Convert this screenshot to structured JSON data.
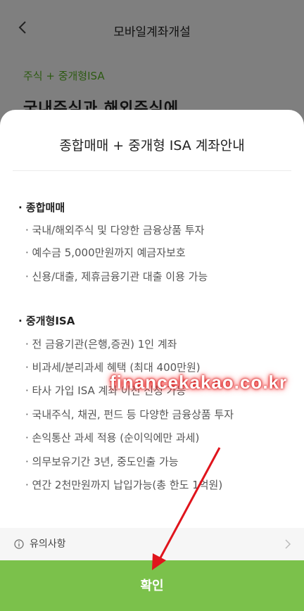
{
  "header": {
    "title": "모바일계좌개설"
  },
  "background": {
    "subtitle": "주식 + 중개형ISA",
    "heading": "국내주식과 해외주식에"
  },
  "sheet": {
    "title": "종합매매 + 중개형 ISA 계좌안내",
    "sections": [
      {
        "title": "· 종합매매",
        "items": [
          "· 국내/해외주식 및 다양한 금융상품 투자",
          "· 예수금 5,000만원까지 예금자보호",
          "· 신용/대출, 제휴금융기관 대출 이용 가능"
        ]
      },
      {
        "title": "· 중개형ISA",
        "items": [
          "· 전 금융기관(은행,증권) 1인 계좌",
          "· 비과세/분리과세 혜택 (최대 400만원)",
          "· 타사 가입 ISA 계좌 이전 신청 가능",
          "· 국내주식, 채권, 펀드 등 다양한 금융상품 투자",
          "· 손익통산 과세 적용 (순이익에만 과세)",
          "· 의무보유기간 3년, 중도인출 가능",
          "· 연간 2천만원까지 납입가능(총 한도 1억원)"
        ]
      }
    ],
    "notice_label": "유의사항",
    "confirm_label": "확인"
  },
  "overlay": {
    "watermark": "financekakao.co.kr",
    "arrow_color": "#e0141c"
  },
  "icons": {
    "back": "back-arrow-icon",
    "info": "info-icon",
    "chevron": "chevron-right-icon"
  },
  "colors": {
    "accent_green": "#7bc14b",
    "subtitle_green": "#2d5a12",
    "dim_background": "#7f7f7f"
  }
}
